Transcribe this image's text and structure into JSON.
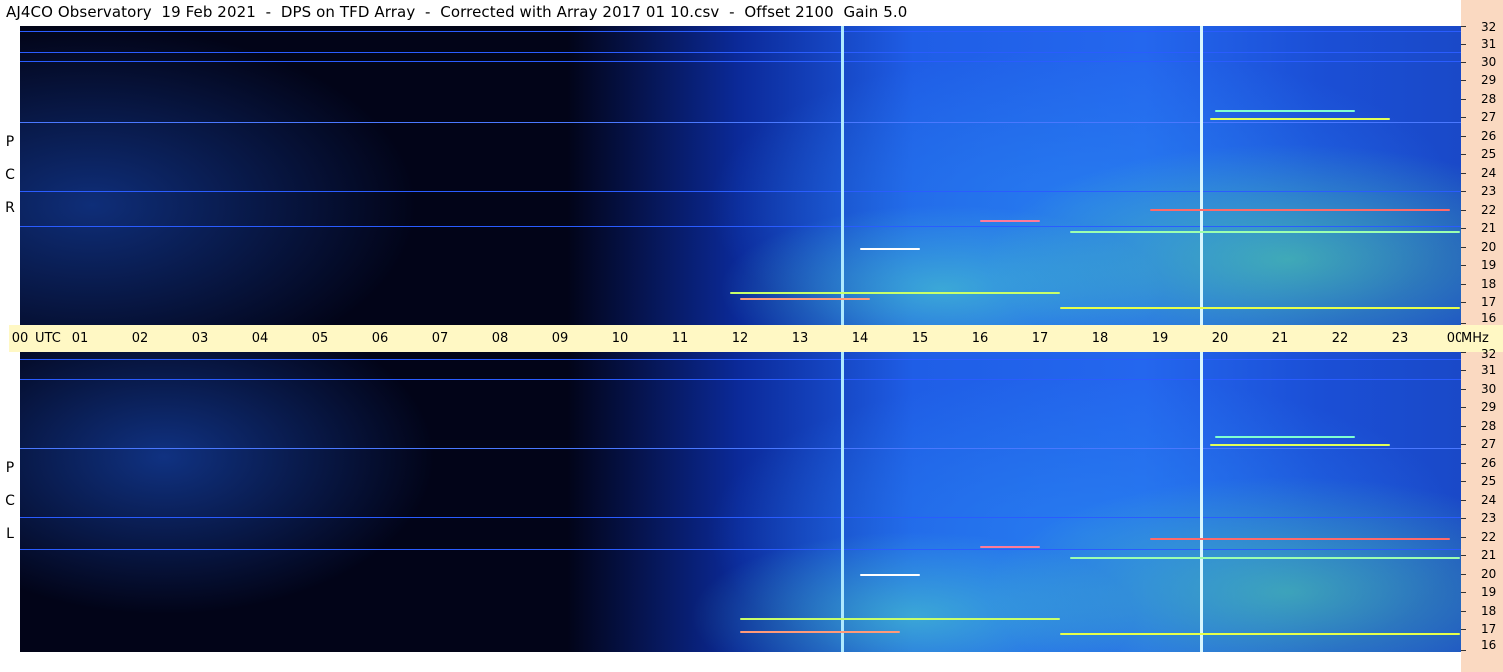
{
  "window": {
    "title": "AJ4CO Observatory  19 Feb 2021  -  DPS on TFD Array  -  Corrected with Array 2017 01 10.csv  -  Offset 2100  Gain 5.0"
  },
  "panels": {
    "top": {
      "polarization_letters": [
        "R",
        "C",
        "P"
      ]
    },
    "bottom": {
      "polarization_letters": [
        "L",
        "C",
        "P"
      ]
    }
  },
  "time_axis": {
    "unit_label": "UTC",
    "freq_unit": "MHz",
    "hour_labels": [
      "00",
      "01",
      "02",
      "03",
      "04",
      "05",
      "06",
      "07",
      "08",
      "09",
      "10",
      "11",
      "12",
      "13",
      "14",
      "15",
      "16",
      "17",
      "18",
      "19",
      "20",
      "21",
      "22",
      "23",
      "00"
    ]
  },
  "frequency_axis": {
    "labels": [
      "32",
      "31",
      "30",
      "29",
      "28",
      "27",
      "26",
      "25",
      "24",
      "23",
      "22",
      "21",
      "20",
      "19",
      "18",
      "17",
      "16"
    ]
  },
  "colors": {
    "background_dark": "#02031a",
    "spectrum_blue": "#1e62e0",
    "spectrum_cyan": "#2fd2e8",
    "spectrum_yellow": "#e6ff4a",
    "utc_bar": "#fff8c4",
    "freq_scale": "#fad9c1"
  }
}
